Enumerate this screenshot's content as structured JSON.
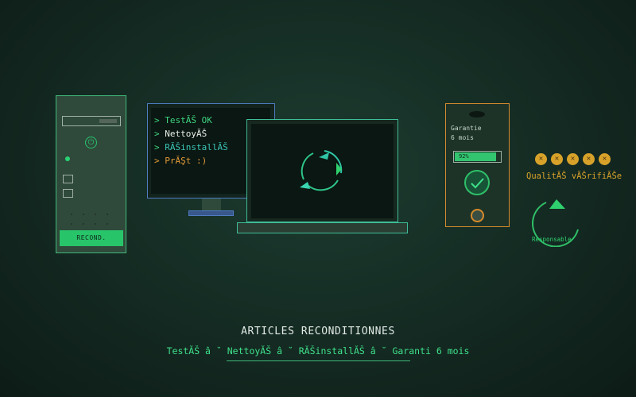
{
  "tower": {
    "power_icon": "power-icon",
    "button_label": "RECOND."
  },
  "monitor": {
    "terminal_lines": [
      {
        "prompt": ">",
        "text": "TestĂŠ OK",
        "color": "#3fd37f"
      },
      {
        "prompt": ">",
        "text": "NettoyĂŠ",
        "color": "#e9efe9"
      },
      {
        "prompt": ">",
        "text": "RĂŠinstallĂŠ",
        "color": "#3bc4b5"
      },
      {
        "prompt": ">",
        "text": "PrĂŞt :)",
        "color": "#e39a3a"
      }
    ]
  },
  "laptop": {
    "icon": "refresh-icon"
  },
  "phone": {
    "warranty_label": "Garantie",
    "warranty_duration": "6 mois",
    "battery_text": "92%",
    "battery_level": 0.92,
    "check_icon": "check-icon"
  },
  "badges": {
    "rating_stars": 5,
    "quality_label": "QualitĂŠ vĂŠrifiĂŠe",
    "responsible_label": "Responsable"
  },
  "footer": {
    "title": "ARTICLES RECONDITIONNES",
    "subtitle": "TestĂŠ â ˘ NettoyĂŠ â ˘ RĂŠinstallĂŠ â ˘ Garanti 6 mois"
  },
  "colors": {
    "accent_green": "#2fd16e",
    "monitor_border": "#4e7bc0",
    "phone_border": "#d58a2b",
    "gold": "#d8a22a"
  }
}
